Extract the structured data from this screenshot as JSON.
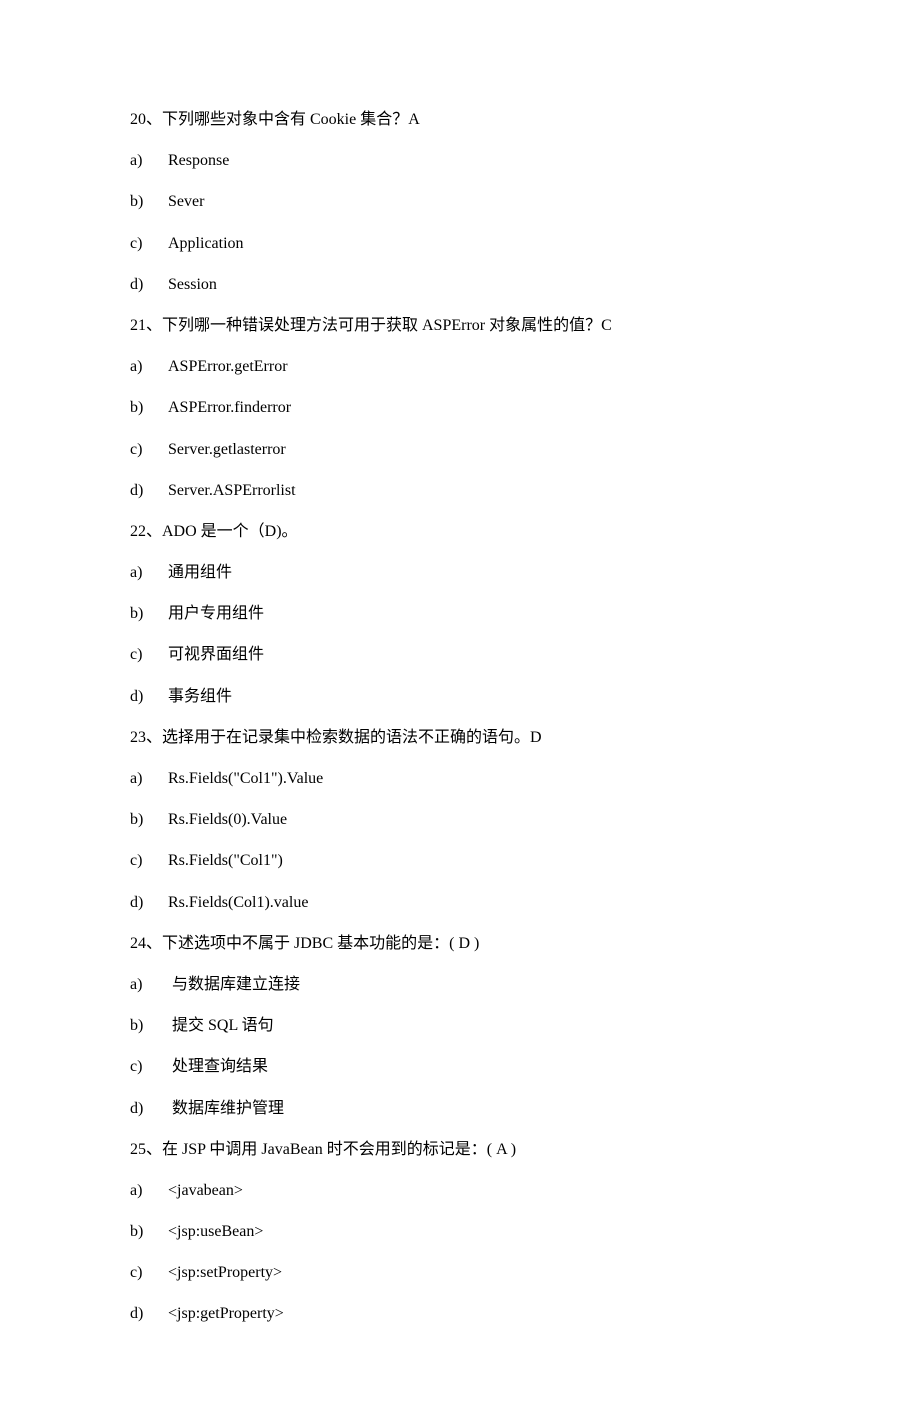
{
  "questions": [
    {
      "q_text": "20、下列哪些对象中含有 Cookie 集合？A",
      "options": [
        {
          "label": "a)",
          "text": "Response"
        },
        {
          "label": "b)",
          "text": "Sever"
        },
        {
          "label": "c)",
          "text": "Application"
        },
        {
          "label": "d)",
          "text": "Session"
        }
      ]
    },
    {
      "q_text": "21、下列哪一种错误处理方法可用于获取 ASPError 对象属性的值？C",
      "options": [
        {
          "label": "a)",
          "text": "ASPError.getError"
        },
        {
          "label": "b)",
          "text": "ASPError.finderror"
        },
        {
          "label": "c)",
          "text": "Server.getlasterror"
        },
        {
          "label": "d)",
          "text": "Server.ASPErrorlist"
        }
      ]
    },
    {
      "q_text": "22、ADO 是一个（D)。",
      "options": [
        {
          "label": "a)",
          "text": "通用组件"
        },
        {
          "label": "b)",
          "text": "用户专用组件"
        },
        {
          "label": "c)",
          "text": "可视界面组件"
        },
        {
          "label": "d)",
          "text": "事务组件"
        }
      ]
    },
    {
      "q_text": "23、选择用于在记录集中检索数据的语法不正确的语句。D",
      "options": [
        {
          "label": "a)",
          "text": "Rs.Fields(\"Col1\").Value"
        },
        {
          "label": "b)",
          "text": "Rs.Fields(0).Value"
        },
        {
          "label": "c)",
          "text": "Rs.Fields(\"Col1\")"
        },
        {
          "label": "d)",
          "text": "Rs.Fields(Col1).value"
        }
      ]
    },
    {
      "q_text": "24、下述选项中不属于 JDBC 基本功能的是：( D )",
      "options": [
        {
          "label": "a)",
          "text": " 与数据库建立连接"
        },
        {
          "label": "b)",
          "text": " 提交 SQL 语句"
        },
        {
          "label": "c)",
          "text": " 处理查询结果"
        },
        {
          "label": "d)",
          "text": " 数据库维护管理"
        }
      ]
    },
    {
      "q_text": "25、在 JSP 中调用 JavaBean 时不会用到的标记是：( A )",
      "options": [
        {
          "label": "a)",
          "text": "<javabean>"
        },
        {
          "label": "b)",
          "text": "<jsp:useBean>"
        },
        {
          "label": "c)",
          "text": "<jsp:setProperty>"
        },
        {
          "label": "d)",
          "text": "<jsp:getProperty>"
        }
      ]
    }
  ]
}
